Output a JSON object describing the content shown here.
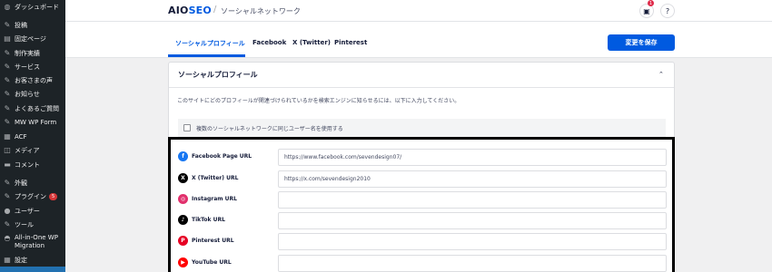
{
  "sidebar": {
    "items": [
      {
        "label": "ダッシュボード",
        "icon": "dashboard-icon",
        "glyph": "◍"
      },
      {
        "label": "投稿",
        "icon": "pin-icon",
        "glyph": "✎"
      },
      {
        "label": "固定ページ",
        "icon": "pages-icon",
        "glyph": "▤"
      },
      {
        "label": "制作実績",
        "icon": "pin-icon",
        "glyph": "✎"
      },
      {
        "label": "サービス",
        "icon": "pin-icon",
        "glyph": "✎"
      },
      {
        "label": "お客さまの声",
        "icon": "pin-icon",
        "glyph": "✎"
      },
      {
        "label": "お知らせ",
        "icon": "pin-icon",
        "glyph": "✎"
      },
      {
        "label": "よくあるご質問",
        "icon": "pin-icon",
        "glyph": "✎"
      },
      {
        "label": "MW WP Form",
        "icon": "pin-icon",
        "glyph": "✎"
      },
      {
        "label": "ACF",
        "icon": "acf-icon",
        "glyph": "▦"
      },
      {
        "label": "メディア",
        "icon": "media-icon",
        "glyph": "◫"
      },
      {
        "label": "コメント",
        "icon": "comment-icon",
        "glyph": "▬"
      },
      {
        "label": "外観",
        "icon": "appearance-icon",
        "glyph": "✎"
      },
      {
        "label": "プラグイン",
        "icon": "plugin-icon",
        "glyph": "✎",
        "badge": "5"
      },
      {
        "label": "ユーザー",
        "icon": "user-icon",
        "glyph": "●"
      },
      {
        "label": "ツール",
        "icon": "tools-icon",
        "glyph": "✎"
      },
      {
        "label": "All-in-One WP Migration",
        "icon": "migration-icon",
        "glyph": "◓"
      },
      {
        "label": "設定",
        "icon": "settings-icon",
        "glyph": "▦"
      }
    ]
  },
  "header": {
    "logo_main": "AIO",
    "logo_accent": "SEO",
    "separator": "/",
    "title": "ソーシャルネットワーク",
    "notification_count": "1",
    "inbox_glyph": "▣",
    "help_glyph": "?"
  },
  "tabs": {
    "items": [
      "ソーシャルプロフィール",
      "Facebook",
      "X (Twitter)",
      "Pinterest"
    ],
    "save_label": "変更を保存"
  },
  "card": {
    "title": "ソーシャルプロフィール",
    "chevron": "⌃",
    "description": "このサイトにどのプロフィールが関連づけられているかを検索エンジンに知らせるには、以下に入力してください。",
    "checkbox_label": "複数のソーシャルネットワークに同じユーザー名を使用する"
  },
  "profiles": [
    {
      "label": "Facebook Page URL",
      "value": "https://www.facebook.com/sevendesign07/",
      "icon": "facebook-icon",
      "glyph": "f",
      "color": "#1877f2"
    },
    {
      "label": "X (Twitter) URL",
      "value": "https://x.com/sevendesign2010",
      "icon": "x-twitter-icon",
      "glyph": "X",
      "color": "#000000"
    },
    {
      "label": "Instagram URL",
      "value": "",
      "icon": "instagram-icon",
      "glyph": "◎",
      "color": "#e1306c"
    },
    {
      "label": "TikTok URL",
      "value": "",
      "icon": "tiktok-icon",
      "glyph": "♪",
      "color": "#000000"
    },
    {
      "label": "Pinterest URL",
      "value": "",
      "icon": "pinterest-icon",
      "glyph": "P",
      "color": "#e60023"
    },
    {
      "label": "YouTube URL",
      "value": "",
      "icon": "youtube-icon",
      "glyph": "▶",
      "color": "#ff0000"
    }
  ]
}
